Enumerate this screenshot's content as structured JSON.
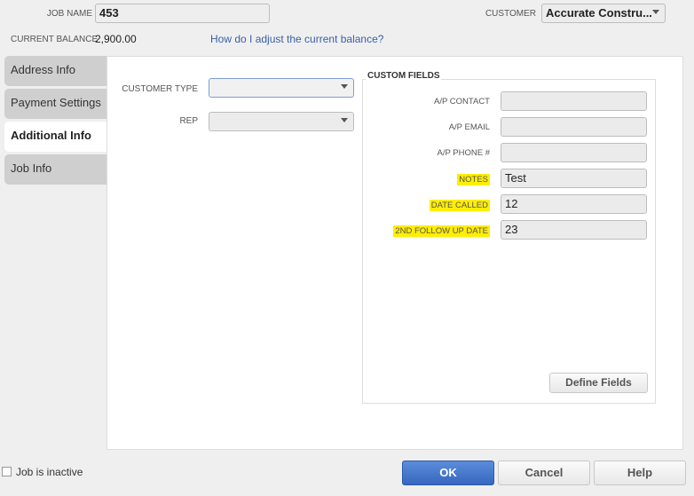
{
  "header": {
    "job_name_label": "JOB NAME",
    "job_name_value": "453",
    "customer_label": "CUSTOMER",
    "customer_value": "Accurate Constru...",
    "balance_label": "CURRENT BALANCE",
    "balance_value": "2,900.00",
    "balance_link": "How do I adjust the current balance?"
  },
  "tabs": [
    {
      "label": "Address Info"
    },
    {
      "label": "Payment Settings"
    },
    {
      "label": "Additional Info"
    },
    {
      "label": "Job Info"
    }
  ],
  "left": {
    "customer_type_label": "CUSTOMER TYPE",
    "customer_type_value": "",
    "rep_label": "REP",
    "rep_value": ""
  },
  "custom_fields": {
    "title": "CUSTOM FIELDS",
    "fields": [
      {
        "label": "A/P CONTACT",
        "value": ""
      },
      {
        "label": "A/P EMAIL",
        "value": ""
      },
      {
        "label": "A/P PHONE #",
        "value": ""
      },
      {
        "label": "NOTES",
        "value": "Test"
      },
      {
        "label": "DATE CALLED",
        "value": "12"
      },
      {
        "label": "2ND FOLLOW UP DATE",
        "value": "23"
      }
    ],
    "define_button": "Define Fields"
  },
  "footer": {
    "inactive_label": "Job is inactive",
    "ok": "OK",
    "cancel": "Cancel",
    "help": "Help"
  },
  "colors": {
    "highlight": "#ffee00",
    "ok_button": "#3f74c9",
    "link": "#3a5fa8"
  }
}
